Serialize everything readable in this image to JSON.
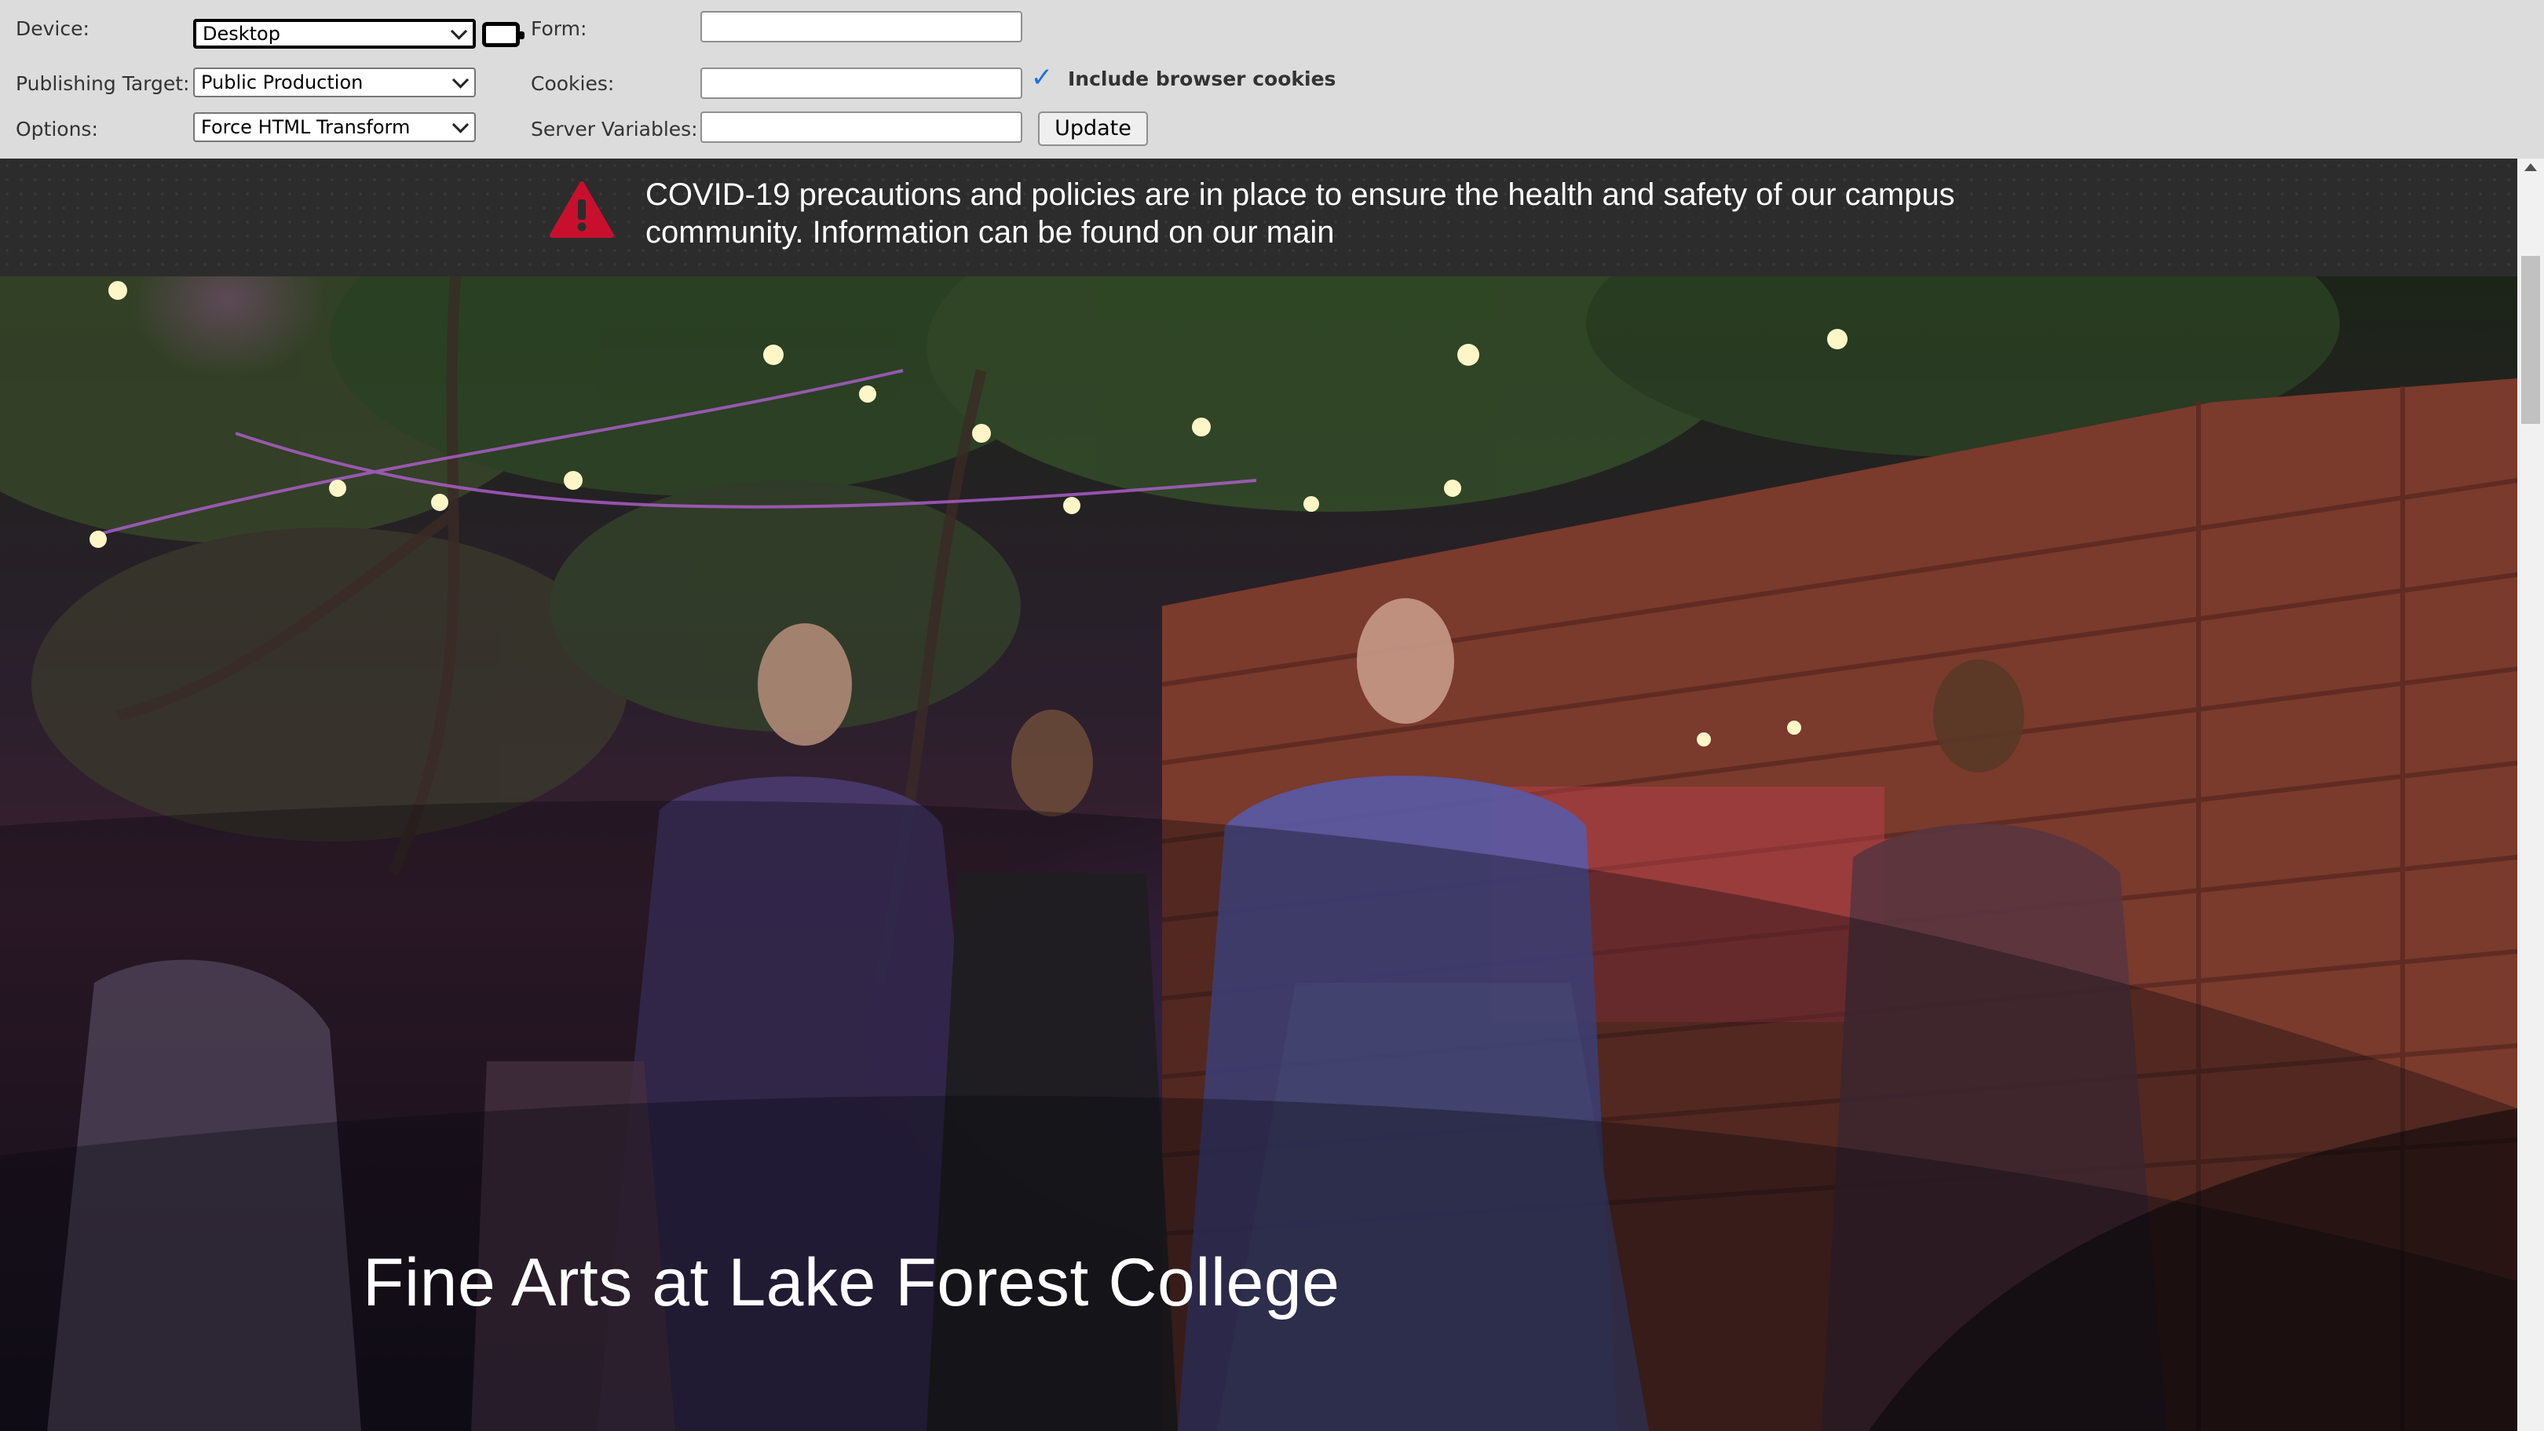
{
  "toolbar": {
    "device": {
      "label": "Device:",
      "value": "Desktop"
    },
    "publishing_target": {
      "label": "Publishing Target:",
      "value": "Public Production"
    },
    "options": {
      "label": "Options:",
      "value": "Force HTML Transform"
    },
    "form": {
      "label": "Form:",
      "value": ""
    },
    "cookies": {
      "label": "Cookies:",
      "value": "",
      "include_browser_cookies_label": "Include browser cookies",
      "include_browser_cookies_checked": true
    },
    "server_variables": {
      "label": "Server Variables:",
      "value": ""
    },
    "update_label": "Update"
  },
  "alert": {
    "icon": "warning-triangle-icon",
    "icon_color": "#c8102e",
    "text": "COVID-19 precautions and policies are in place to ensure the health and safety of our campus community. Information can be found on our main"
  },
  "hero": {
    "title": "Fine Arts at Lake Forest College"
  },
  "colors": {
    "toolbar_bg": "#dcdcdc",
    "alert_bg": "#2c2c2c",
    "accent_red": "#c8102e"
  }
}
